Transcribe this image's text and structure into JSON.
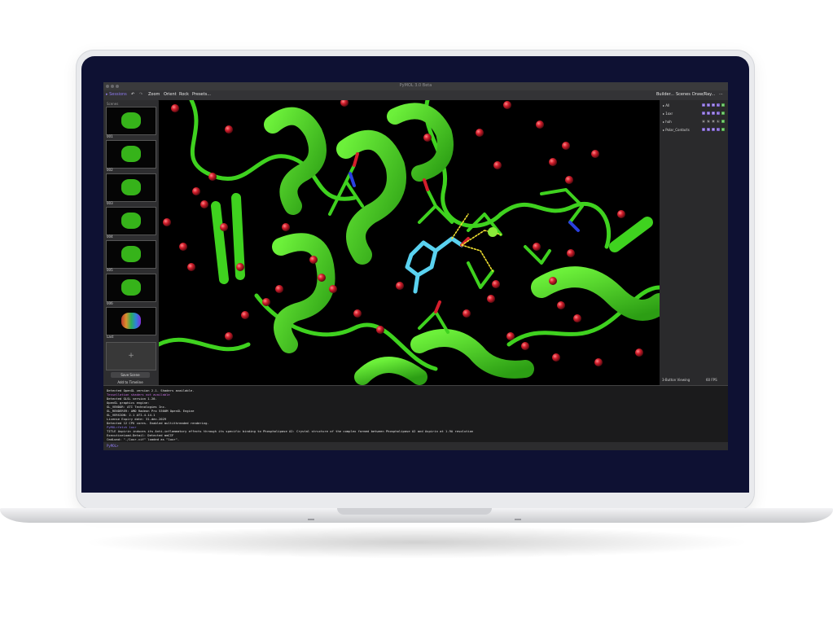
{
  "window": {
    "title": "PyMOL 3.0 Beta",
    "toolbar": {
      "sessions": "▸ Sessions",
      "zoom": "Zoom",
      "orient": "Orient",
      "rock": "Rock",
      "presets": "Presets...",
      "builder": "Builder...",
      "scenes": "Scenes",
      "drawray": "Draw/Ray..."
    },
    "left_panel": {
      "header": "Scenes",
      "scenes": [
        "001",
        "002",
        "003",
        "004",
        "005",
        "006",
        "Last"
      ],
      "add_button": "+",
      "save_button": "Save Scene",
      "timeline_button": "Add to Timeline"
    },
    "objects": [
      {
        "name": "All"
      },
      {
        "name": "1oxr"
      },
      {
        "name": "hoh"
      },
      {
        "name": "Polar_Contacts"
      }
    ],
    "viewport_status": {
      "mode": "3-Button Viewing",
      "fps": "60 FPS"
    },
    "console": [
      "Detected OpenGL version 2.1. Shaders available.",
      "Tessellation shaders not available",
      "Detected GLSL version 1.20.",
      "OpenGL graphics engine:",
      " GL_VENDOR:   ATI Technologies Inc.",
      " GL_RENDERER: AMD Radeon Pro 5300M OpenGL Engine",
      " GL_VERSION:  2.1 ATI-4.14.1",
      "License Expiry date: 31-dec-2029",
      "Detected 12 CPU cores.  Enabled multithreaded rendering.",
      "PyMOL>fetch 1oxr",
      "TITLE     Aspirin induces its Anti-inflammatory effects through its specific binding to Phospholipase A2: Crystal structure of the complex formed between Phospholipase A2 and Aspirin at 1.9A resolution",
      "ExecutiveLoad-Detail: Detected mmCIF",
      "CmdLoad: \"./1oxr.cif\" loaded as \"1oxr\"."
    ],
    "prompt": "PyMOL>"
  },
  "colors": {
    "bezel": "#0e1133",
    "protein": "#3fd21f",
    "water": "#d41e2c",
    "ligand": "#5ad2f0",
    "hbond": "#f0e030",
    "accent": "#7a5fc9"
  }
}
